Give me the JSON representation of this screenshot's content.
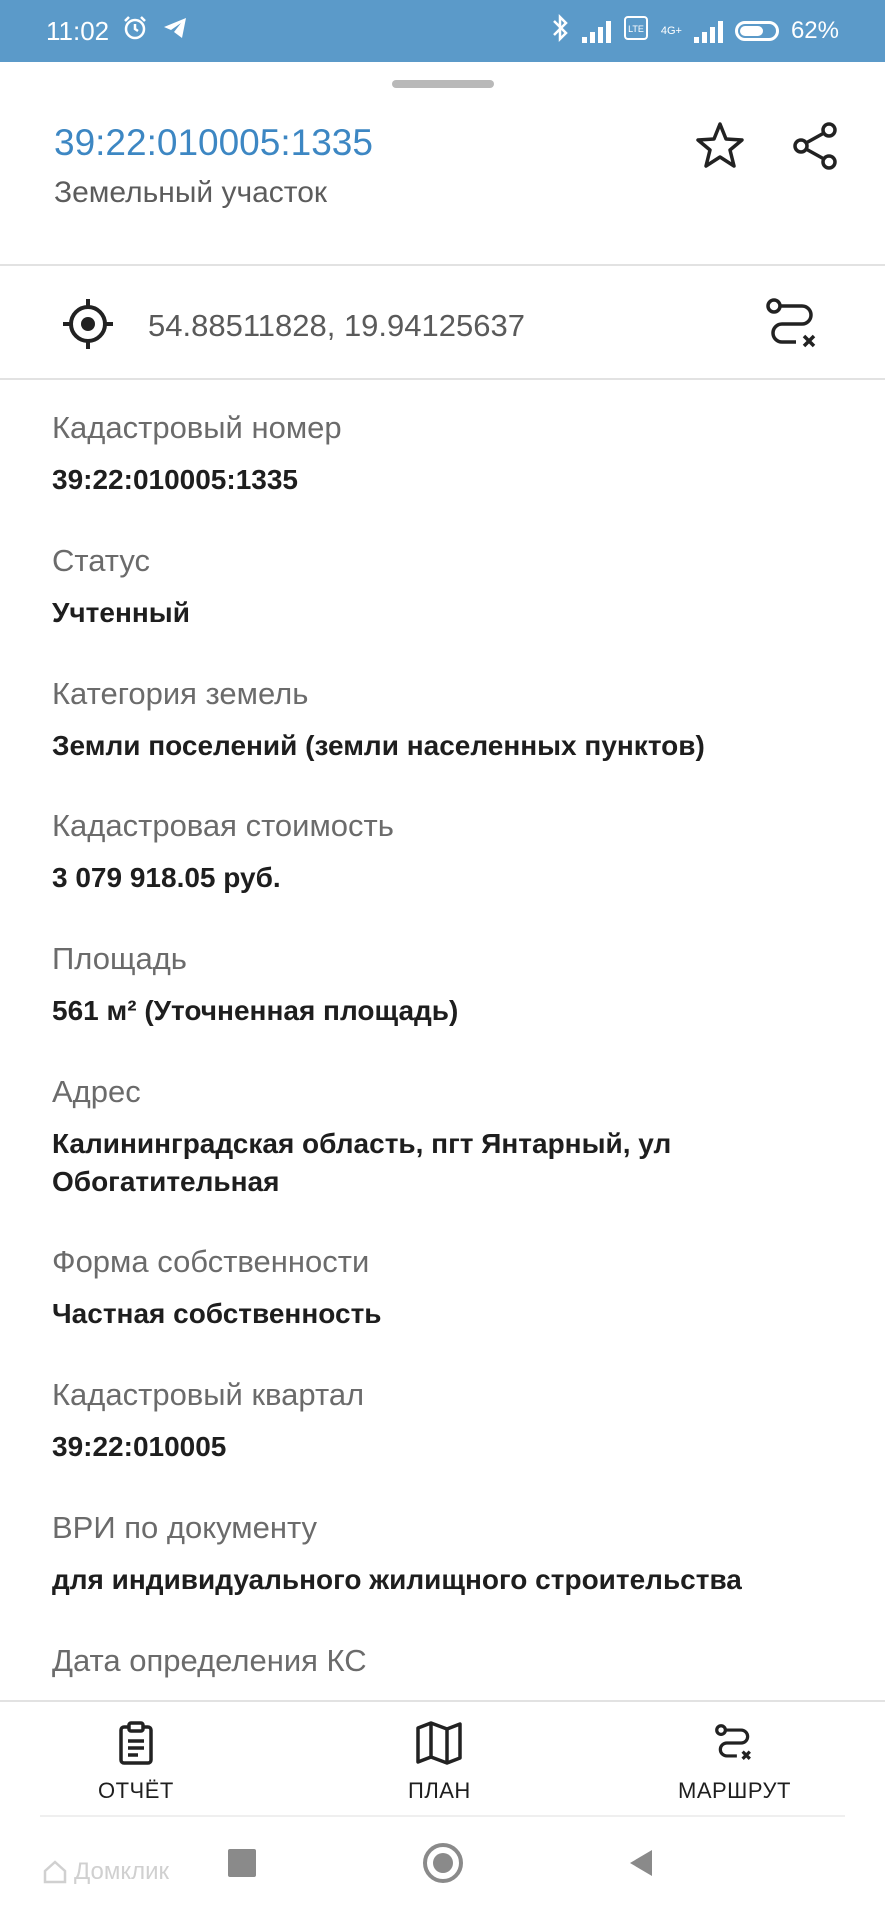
{
  "status_bar": {
    "time": "11:02",
    "battery": "62%",
    "network_badge": "4G+"
  },
  "header": {
    "title": "39:22:010005:1335",
    "subtitle": "Земельный участок"
  },
  "coordinates": "54.88511828, 19.94125637",
  "fields": [
    {
      "label": "Кадастровый номер",
      "value": "39:22:010005:1335"
    },
    {
      "label": "Статус",
      "value": "Учтенный"
    },
    {
      "label": "Категория земель",
      "value": "Земли поселений (земли населенных пунктов)"
    },
    {
      "label": "Кадастровая стоимость",
      "value": "3 079 918.05 руб."
    },
    {
      "label": "Площадь",
      "value": "561 м² (Уточненная площадь)"
    },
    {
      "label": "Адрес",
      "value": "Калининградская область, пгт Янтарный, ул Обогатительная"
    },
    {
      "label": "Форма собственности",
      "value": "Частная собственность"
    },
    {
      "label": "Кадастровый квартал",
      "value": "39:22:010005"
    },
    {
      "label": "ВРИ по документу",
      "value": "для индивидуального жилищного строительства"
    },
    {
      "label": "Дата определения КС",
      "value": ""
    }
  ],
  "bottom_nav": [
    {
      "label": "ОТЧЁТ",
      "icon": "report-icon"
    },
    {
      "label": "ПЛАН",
      "icon": "map-icon"
    },
    {
      "label": "МАРШРУТ",
      "icon": "route-icon"
    }
  ],
  "watermark": "Домклик"
}
